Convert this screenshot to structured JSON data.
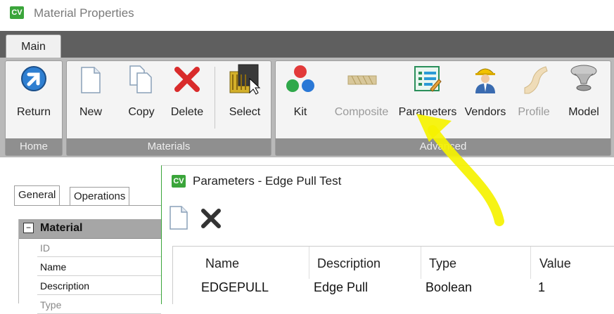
{
  "window": {
    "app_icon_text": "CV",
    "title": "Material Properties"
  },
  "ribbon": {
    "tab": "Main",
    "groups": [
      {
        "label": "Home",
        "buttons": [
          {
            "label": "Return",
            "icon": "return-arrow-icon",
            "enabled": true
          }
        ]
      },
      {
        "label": "Materials",
        "buttons": [
          {
            "label": "New",
            "icon": "new-document-icon",
            "enabled": true
          },
          {
            "label": "Copy",
            "icon": "copy-documents-icon",
            "enabled": true
          },
          {
            "label": "Delete",
            "icon": "red-x-icon",
            "enabled": true
          },
          {
            "label": "Select",
            "icon": "select-material-icon",
            "enabled": true
          }
        ]
      },
      {
        "label": "Advanced",
        "buttons": [
          {
            "label": "Kit",
            "icon": "kit-balls-icon",
            "enabled": true
          },
          {
            "label": "Composite",
            "icon": "composite-board-icon",
            "enabled": false
          },
          {
            "label": "Parameters",
            "icon": "parameters-list-icon",
            "enabled": true
          },
          {
            "label": "Vendors",
            "icon": "vendor-worker-icon",
            "enabled": true
          },
          {
            "label": "Profile",
            "icon": "profile-molding-icon",
            "enabled": false
          },
          {
            "label": "Model",
            "icon": "model-knob-icon",
            "enabled": true
          }
        ]
      }
    ]
  },
  "properties": {
    "tabs": [
      "General",
      "Operations"
    ],
    "active_tab": "General",
    "section": {
      "expander": "−",
      "title": "Material"
    },
    "rows": [
      "ID",
      "Name",
      "Description",
      "Type"
    ]
  },
  "dialog": {
    "icon_text": "CV",
    "title": "Parameters - Edge Pull Test",
    "columns": [
      "Name",
      "Description",
      "Type",
      "Value"
    ],
    "rows": [
      {
        "name": "EDGEPULL",
        "description": "Edge Pull",
        "type": "Boolean",
        "value": "1"
      }
    ]
  },
  "colors": {
    "accent_green": "#3aa53a",
    "highlight_arrow": "#f5f200",
    "ribbon_dark": "#5f5f5f"
  }
}
